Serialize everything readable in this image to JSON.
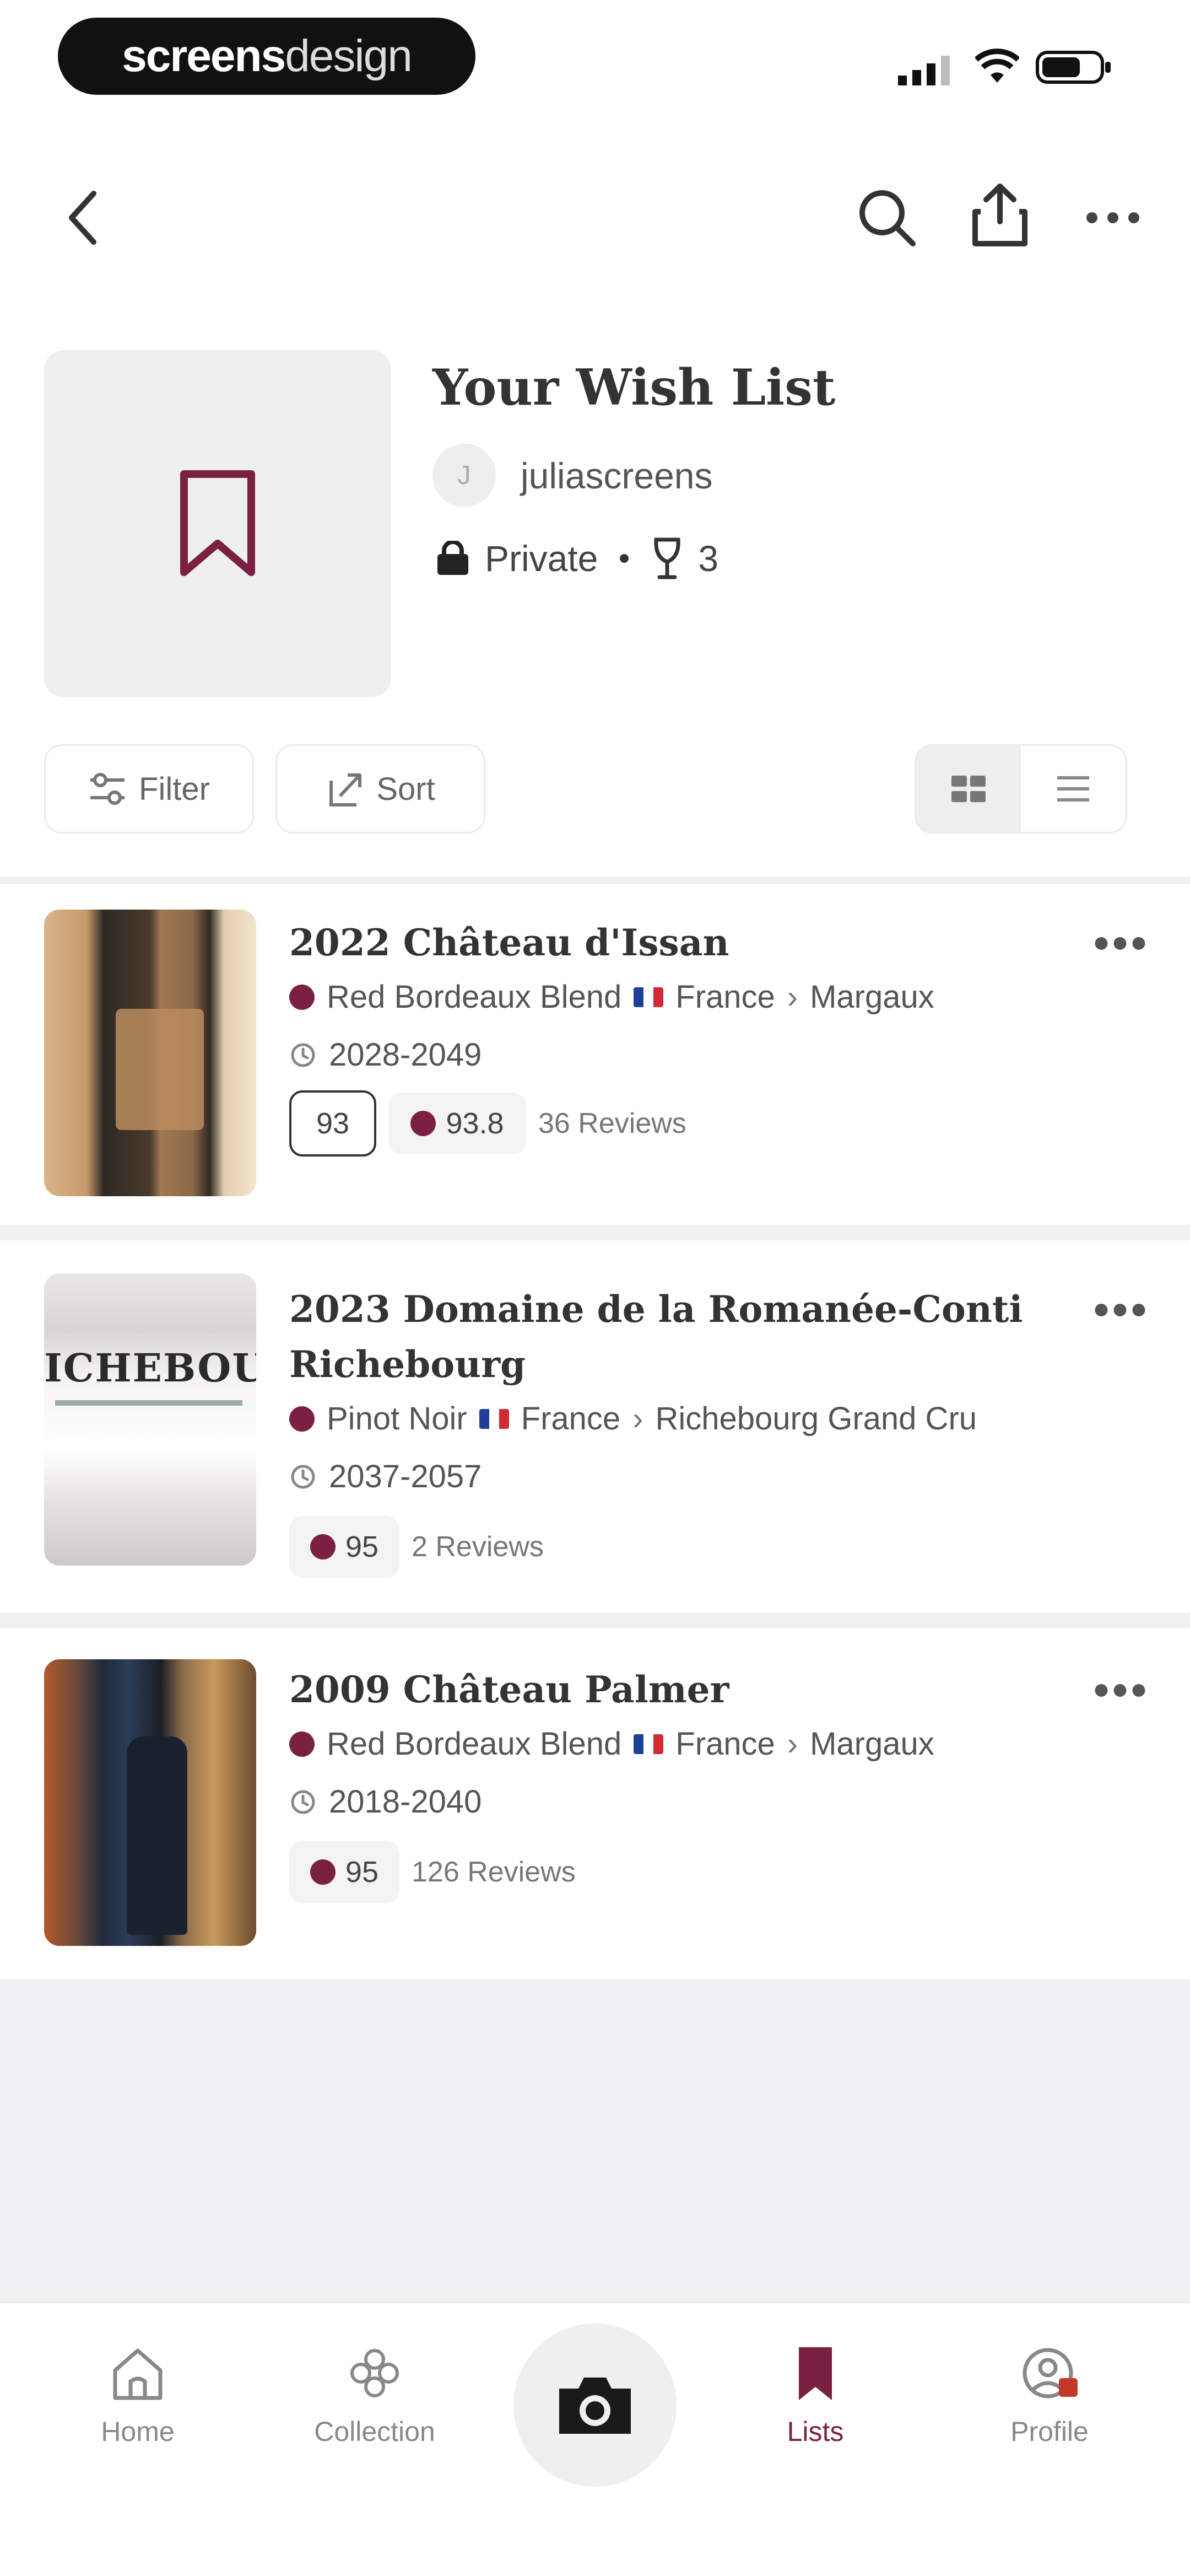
{
  "status_bar": {
    "brand_bold": "screens",
    "brand_light": "design"
  },
  "header": {
    "back_icon": "chevron-left-icon",
    "search_icon": "search-icon",
    "share_icon": "share-icon",
    "more_icon": "more-horizontal-icon"
  },
  "list": {
    "title": "Your Wish List",
    "avatar_initial": "J",
    "username": "juliascreens",
    "privacy": "Private",
    "count": "3"
  },
  "controls": {
    "filter_label": "Filter",
    "sort_label": "Sort"
  },
  "wines": [
    {
      "name": "2022 Château d'Issan",
      "style": "Red Bordeaux Blend",
      "country": "France",
      "region": "Margaux",
      "drinking_window": "2028-2049",
      "critic_score": "93",
      "rating": "93.8",
      "reviews": "36 Reviews"
    },
    {
      "name": "2023 Domaine de la Romanée-Conti Richebourg",
      "label_text": "ICHEBOUR",
      "style": "Pinot Noir",
      "country": "France",
      "region": "Richebourg Grand Cru",
      "drinking_window": "2037-2057",
      "rating": "95",
      "reviews": "2 Reviews"
    },
    {
      "name": "2009 Château Palmer",
      "style": "Red Bordeaux Blend",
      "country": "France",
      "region": "Margaux",
      "drinking_window": "2018-2040",
      "rating": "95",
      "reviews": "126 Reviews"
    }
  ],
  "tabbar": {
    "home": "Home",
    "collection": "Collection",
    "lists": "Lists",
    "profile": "Profile"
  },
  "colors": {
    "accent": "#7a2142",
    "muted": "#888888",
    "surface": "#f1f1f3"
  }
}
